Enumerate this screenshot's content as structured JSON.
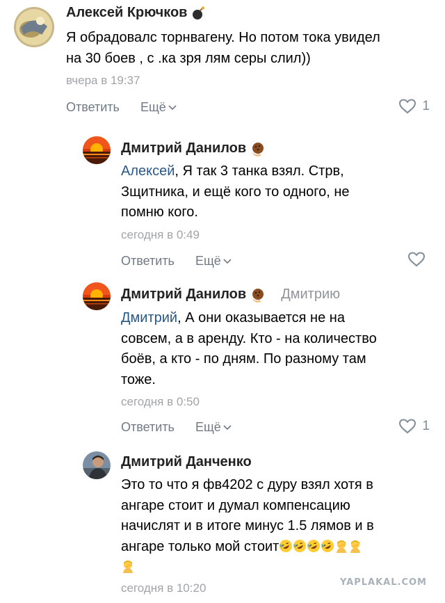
{
  "comments": [
    {
      "author": "Алексей Крючков",
      "badge": "bomb-icon",
      "reply_to": "",
      "mention": "",
      "text_lines": [
        "Я обрадовалс торнвагену. Но потом тока увидел",
        "на 30 боев , с .ка зря лям серы слил))"
      ],
      "time": "вчера в 19:37",
      "reply_label": "Ответить",
      "more_label": "Ещё",
      "likes": "1"
    },
    {
      "author": "Дмитрий Данилов",
      "badge": "cookie-hand-icon",
      "reply_to": "",
      "mention": "Алексей",
      "text_lines": [
        ", Я так 3 танка взял. Стрв,",
        "Зщитника, и ещё кого то одного, не",
        "помню кого."
      ],
      "time": "сегодня в 0:49",
      "reply_label": "Ответить",
      "more_label": "Ещё",
      "likes": ""
    },
    {
      "author": "Дмитрий Данилов",
      "badge": "cookie-hand-icon",
      "reply_to": "Дмитрию",
      "mention": "Дмитрий",
      "text_lines": [
        ", А они оказывается не на",
        "совсем, а в аренду. Кто - на количество",
        "боёв, а кто - по дням. По разному там",
        "тоже."
      ],
      "time": "сегодня в 0:50",
      "reply_label": "Ответить",
      "more_label": "Ещё",
      "likes": "1"
    },
    {
      "author": "Дмитрий Данченко",
      "badge": "",
      "reply_to": "",
      "mention": "",
      "text_lines": [
        "Это то что я фв4202 с дуру взял хотя в",
        "ангаре стоит и думал компенсацию",
        "начислят и в итоге минус 1.5 лямов и в",
        "ангаре только мой стоит"
      ],
      "emojis": [
        "rofl-emoji",
        "rofl-emoji",
        "rofl-emoji",
        "rofl-emoji",
        "man-facepalming-emoji",
        "man-facepalming-emoji",
        "man-facepalming-emoji"
      ],
      "time": "сегодня в 10:20"
    }
  ],
  "watermark": "YAPLAKAL.COM",
  "colors": {
    "mention": "#2a5885",
    "meta": "#a0a4a8",
    "action": "#6f7985",
    "heart": "#818c99"
  }
}
